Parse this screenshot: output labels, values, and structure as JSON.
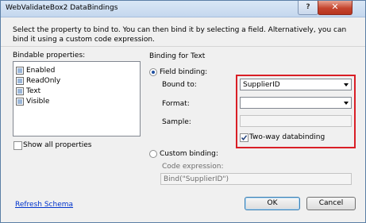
{
  "window": {
    "title": "WebValidateBox2 DataBindings",
    "help_glyph": "?",
    "close_glyph": "✕"
  },
  "description": "Select the property to bind to. You can then bind it by selecting a field. Alternatively, you can bind it using a custom code expression.",
  "bindable": {
    "label": "Bindable properties:",
    "items": [
      "Enabled",
      "ReadOnly",
      "Text",
      "Visible"
    ],
    "show_all_label": "Show all properties"
  },
  "binding": {
    "group_label": "Binding for Text",
    "field_binding_label": "Field binding:",
    "bound_to_label": "Bound to:",
    "bound_to_value": "SupplierID",
    "format_label": "Format:",
    "format_value": "",
    "sample_label": "Sample:",
    "sample_value": "",
    "two_way_label": "Two-way databinding",
    "custom_binding_label": "Custom binding:",
    "code_expression_label": "Code expression:",
    "code_expression_value": "Bind(\"SupplierID\")"
  },
  "footer": {
    "refresh_link": "Refresh Schema",
    "ok_label": "OK",
    "cancel_label": "Cancel"
  },
  "colors": {
    "highlight_border": "#d91f26",
    "link": "#0033cc"
  }
}
